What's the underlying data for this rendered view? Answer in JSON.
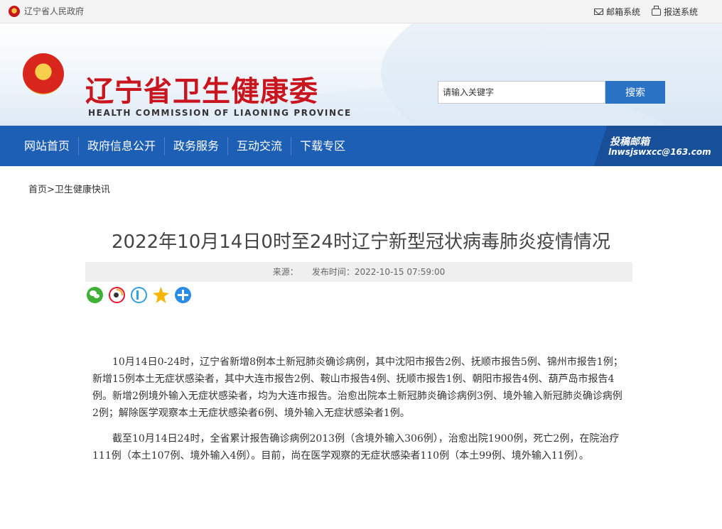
{
  "topbar": {
    "gov_link": "辽宁省人民政府",
    "mail_system": "邮箱系统",
    "report_system": "报送系统"
  },
  "header": {
    "title": "辽宁省卫生健康委",
    "subtitle": "HEALTH COMMISSION OF LIAONING PROVINCE",
    "search_placeholder": "请输入关键字",
    "search_button": "搜索"
  },
  "nav": {
    "items": [
      "网站首页",
      "政府信息公开",
      "政务服务",
      "互动交流",
      "下载专区"
    ],
    "mailbox_title": "投稿邮箱",
    "mailbox_email": "lnwsjswxcc@163.com"
  },
  "breadcrumb": {
    "home": "首页",
    "separator": ">",
    "section": "卫生健康快讯"
  },
  "article": {
    "title": "2022年10月14日0时至24时辽宁新型冠状病毒肺炎疫情情况",
    "source_label": "来源：",
    "publish_label": "发布时间：",
    "publish_time": "2022-10-15 07:59:00",
    "share_icons": [
      "wechat-icon",
      "weibo-icon",
      "pp-icon",
      "qzone-icon",
      "more-share-icon"
    ],
    "paragraphs": [
      "10月14日0-24时，辽宁省新增8例本土新冠肺炎确诊病例，其中沈阳市报告2例、抚顺市报告5例、锦州市报告1例；新增15例本土无症状感染者，其中大连市报告2例、鞍山市报告4例、抚顺市报告1例、朝阳市报告4例、葫芦岛市报告4例。新增2例境外输入无症状感染者，均为大连市报告。治愈出院本土新冠肺炎确诊病例3例、境外输入新冠肺炎确诊病例2例；解除医学观察本土无症状感染者6例、境外输入无症状感染者1例。",
      "截至10月14日24时，全省累计报告确诊病例2013例（含境外输入306例），治愈出院1900例，死亡2例，在院治疗111例（本土107例、境外输入4例）。目前，尚在医学观察的无症状感染者110例（本土99例、境外输入11例）。"
    ]
  }
}
